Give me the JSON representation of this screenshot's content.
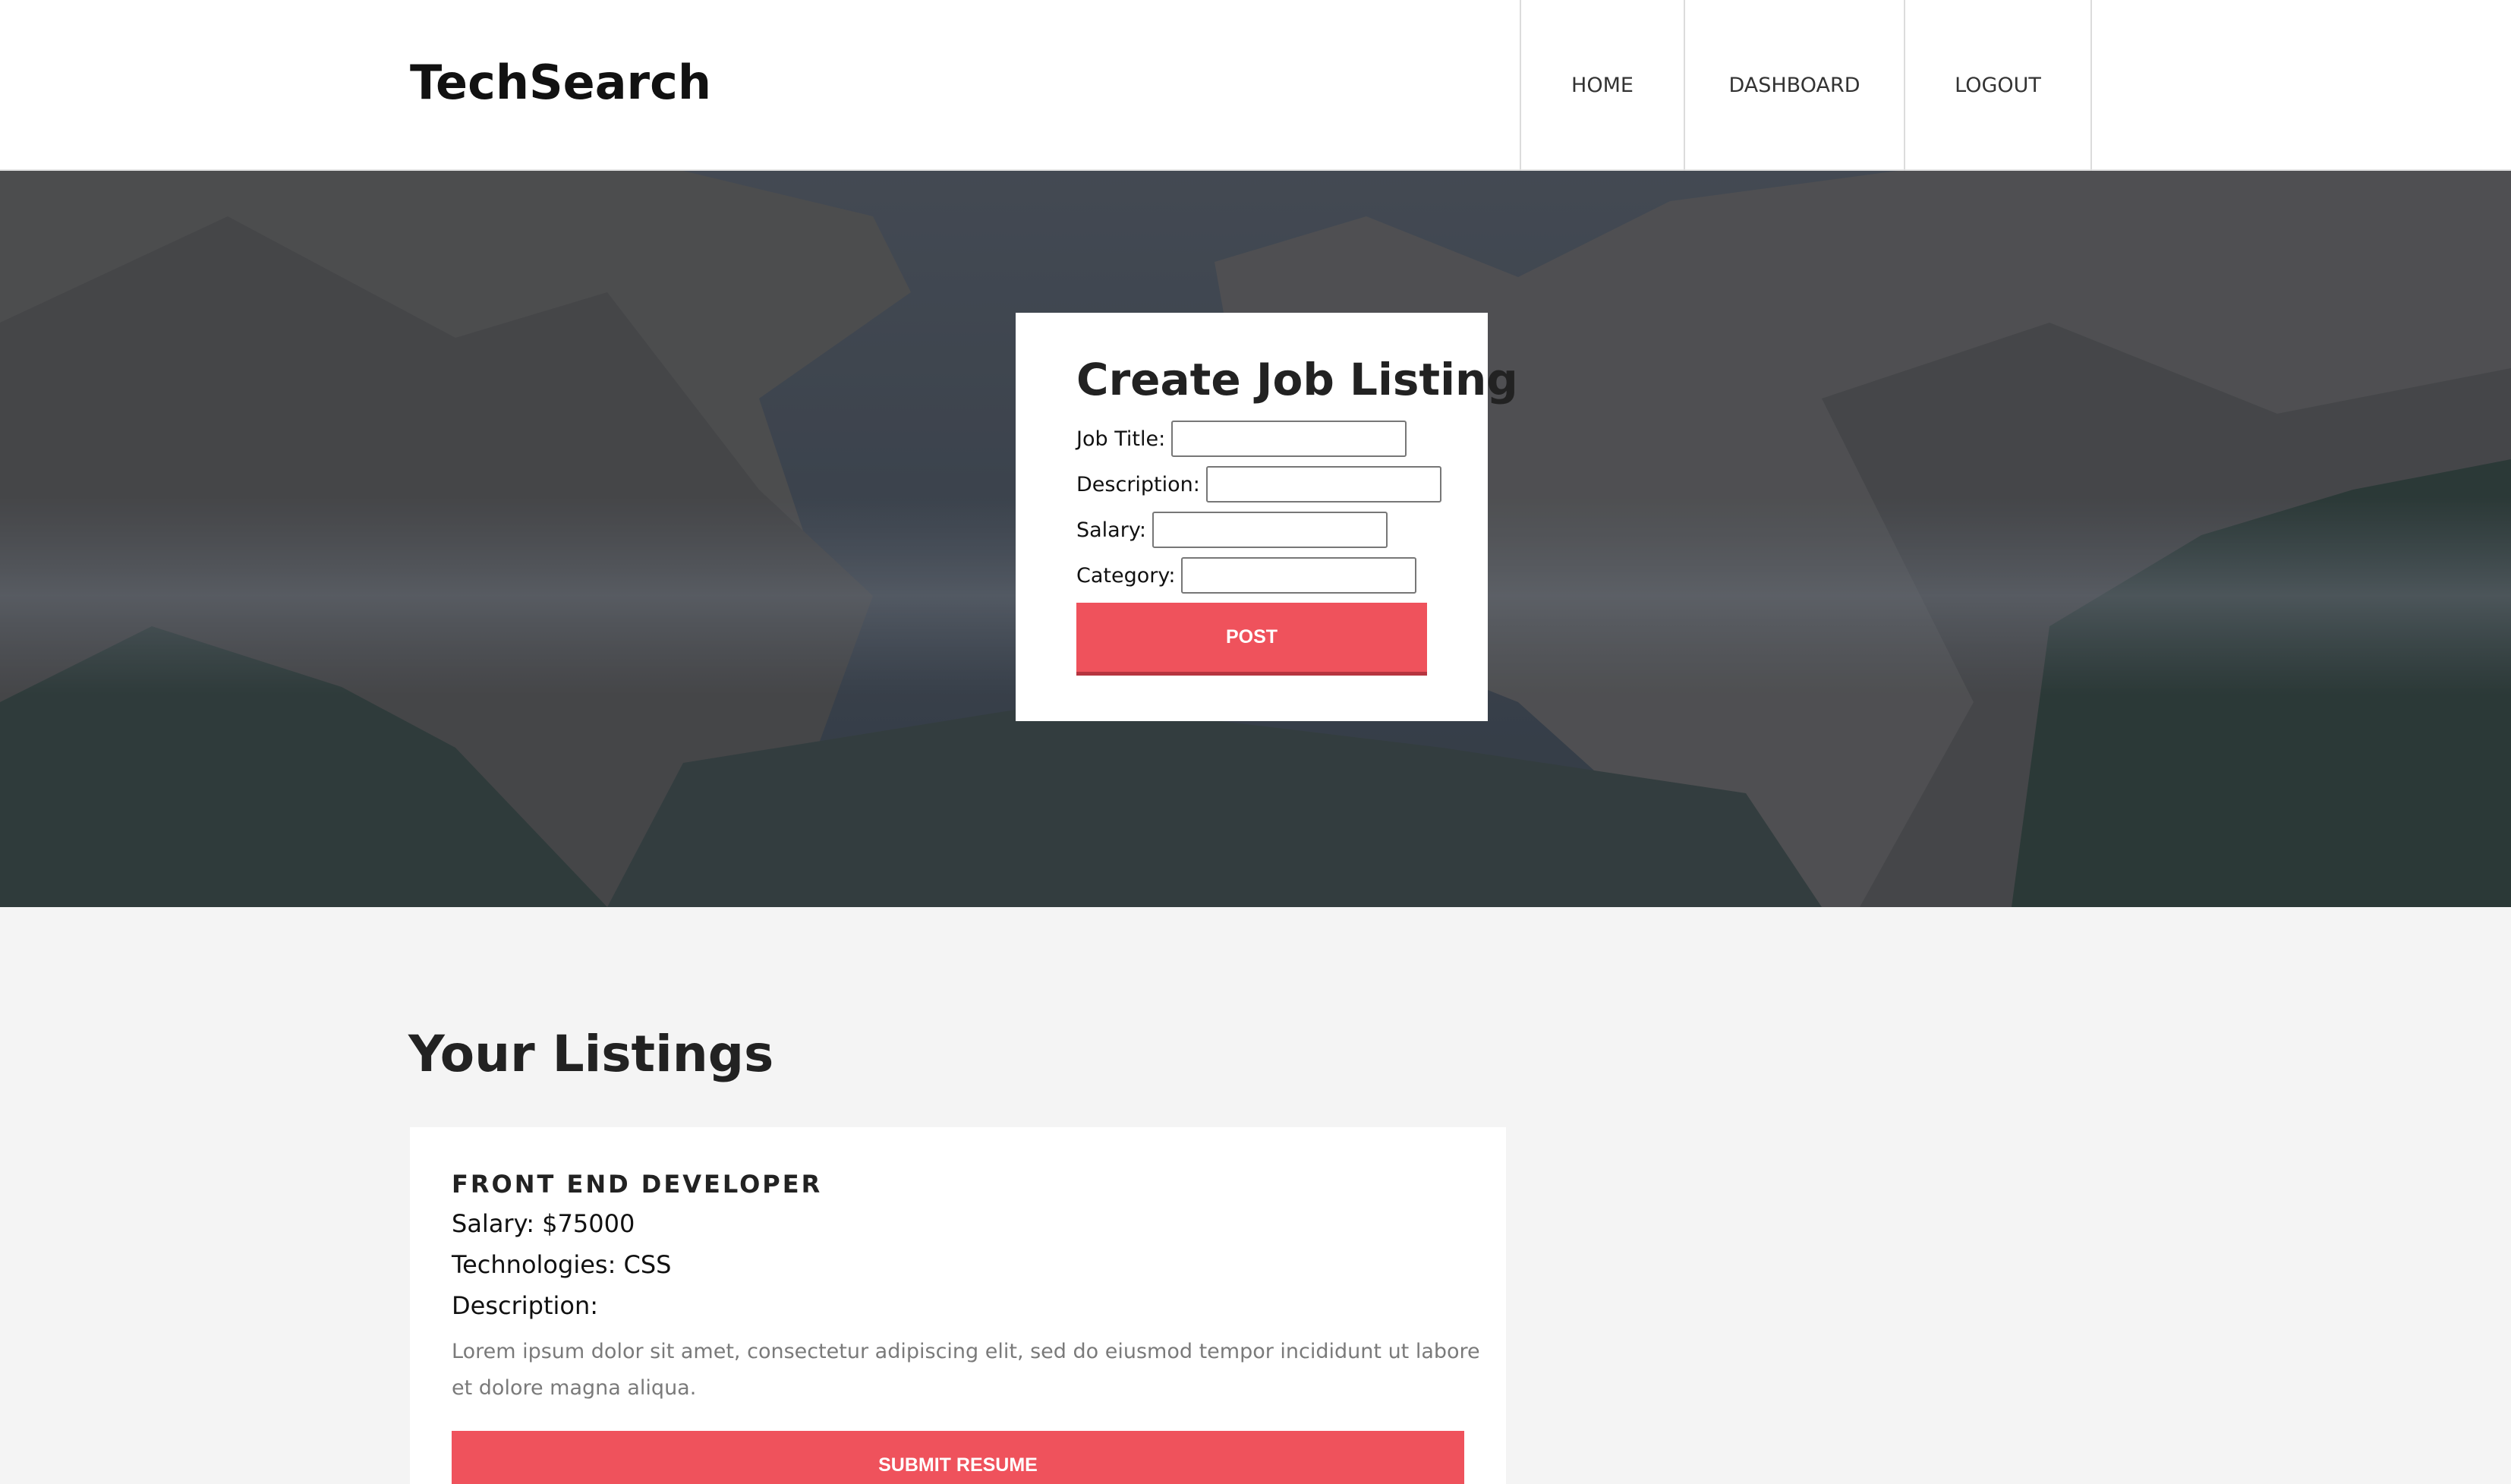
{
  "header": {
    "brand": "TechSearch",
    "nav": {
      "home": "HOME",
      "dashboard": "DASHBOARD",
      "logout": "LOGOUT"
    }
  },
  "form": {
    "title": "Create Job Listing",
    "job_title_label": "Job Title:",
    "description_label": "Description:",
    "salary_label": "Salary:",
    "category_label": "Category:",
    "job_title_value": "",
    "description_value": "",
    "salary_value": "",
    "category_value": "",
    "post_label": "POST"
  },
  "listings": {
    "title": "Your Listings",
    "items": [
      {
        "title": "FRONT END DEVELOPER",
        "salary": "Salary: $75000",
        "technologies": "Technologies: CSS",
        "description_label": "Description:",
        "description": "Lorem ipsum dolor sit amet, consectetur adipiscing elit, sed do eiusmod tempor incididunt ut labore et dolore magna aliqua.",
        "submit_label": "SUBMIT RESUME"
      }
    ]
  },
  "colors": {
    "accent": "#ef525c",
    "accent_dark": "#b63540",
    "header_bg": "#ffffff",
    "page_bg": "#f4f4f4"
  }
}
